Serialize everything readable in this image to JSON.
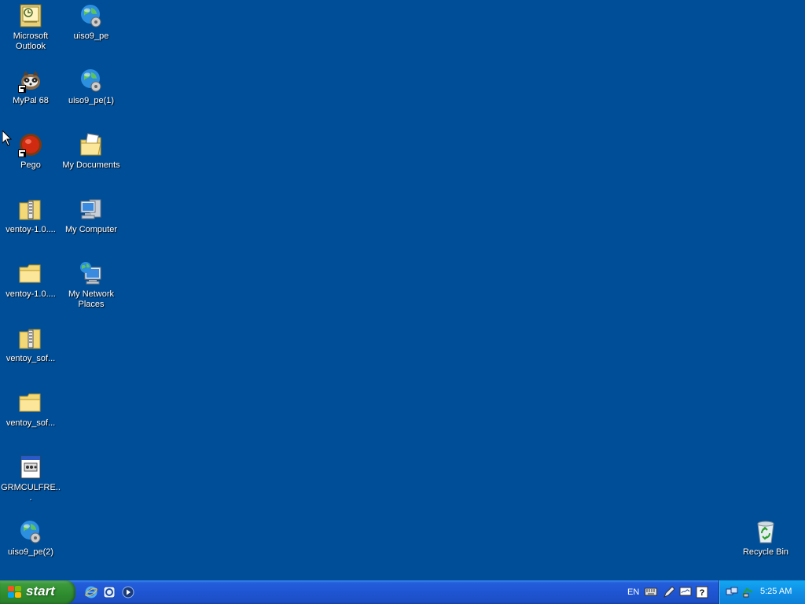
{
  "desktop": {
    "icons": [
      {
        "label": "Microsoft Outlook",
        "icon": "outlook-icon"
      },
      {
        "label": "uiso9_pe",
        "icon": "globe-icon"
      },
      {
        "label": "MyPal 68",
        "icon": "mypal-icon"
      },
      {
        "label": "uiso9_pe(1)",
        "icon": "globe-icon"
      },
      {
        "label": "Pego",
        "icon": "pego-icon"
      },
      {
        "label": "My Documents",
        "icon": "my-documents-icon"
      },
      {
        "label": "ventoy-1.0....",
        "icon": "zip-folder-icon"
      },
      {
        "label": "My Computer",
        "icon": "my-computer-icon"
      },
      {
        "label": "ventoy-1.0....",
        "icon": "folder-icon"
      },
      {
        "label": "My Network Places",
        "icon": "network-places-icon"
      },
      {
        "label": "ventoy_sof...",
        "icon": "zip-folder-icon"
      },
      {
        "label": "ventoy_sof...",
        "icon": "folder-icon"
      },
      {
        "label": "GRMCULFRE...",
        "icon": "disc-image-icon"
      },
      {
        "label": "uiso9_pe(2)",
        "icon": "globe-icon"
      },
      {
        "label": "Recycle Bin",
        "icon": "recycle-bin-icon"
      }
    ],
    "background_color": "#004e98"
  },
  "taskbar": {
    "start_label": "start",
    "quick_launch": [
      "internet-explorer-icon",
      "browser-icon",
      "media-player-icon"
    ],
    "language": "EN",
    "clock": "5:25 AM",
    "accent_color": "#245edb",
    "start_color": "#3c9a3c"
  }
}
